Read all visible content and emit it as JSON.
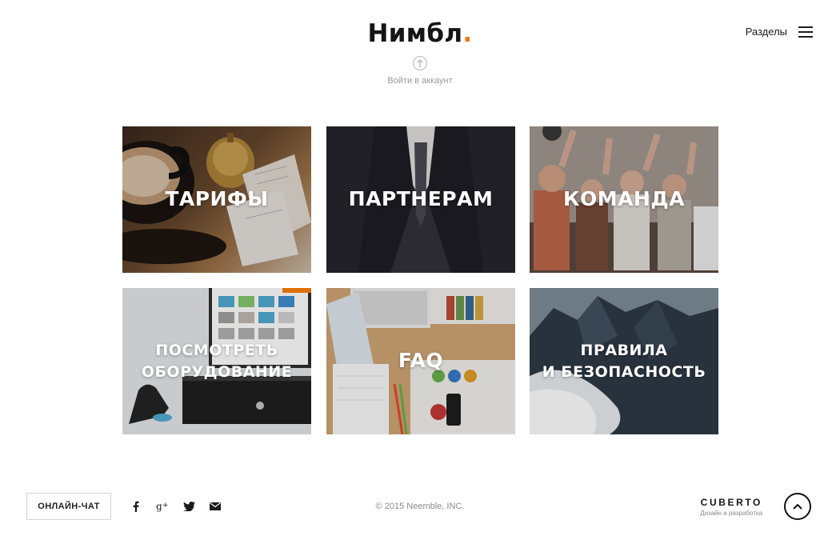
{
  "header": {
    "logo_text": "Нимбл",
    "logo_dot": ".",
    "logo_dot_color": "#f07a0a",
    "login_label": "Войти в аккаунт",
    "login_icon": "upload-arrow-circle-icon",
    "sections_label": "Разделы",
    "menu_icon": "hamburger-menu-icon"
  },
  "tiles": [
    {
      "label": "Тарифы",
      "image": "coffee-cup-bell-receipts"
    },
    {
      "label": "Партнерам",
      "image": "man-in-suit"
    },
    {
      "label": "Команда",
      "image": "team-raising-hands"
    },
    {
      "label_line1": "посмотреть",
      "label_line2": "оборудование",
      "image": "pos-terminal-cash-drawer-scanner"
    },
    {
      "label": "FAQ",
      "image": "desk-keyboard-notebooks"
    },
    {
      "label_line1": "Правила",
      "label_line2": "и безопасность",
      "image": "mountain-above-clouds"
    }
  ],
  "footer": {
    "chat_button": "ОНЛАЙН-ЧАТ",
    "social": [
      "facebook-icon",
      "google-plus-icon",
      "twitter-icon",
      "mail-icon"
    ],
    "copyright": "© 2015 Neemble, INC.",
    "credit_name": "CUBERTO",
    "credit_sub": "Дизайн и разработка",
    "to_top_icon": "chevron-up-icon"
  }
}
